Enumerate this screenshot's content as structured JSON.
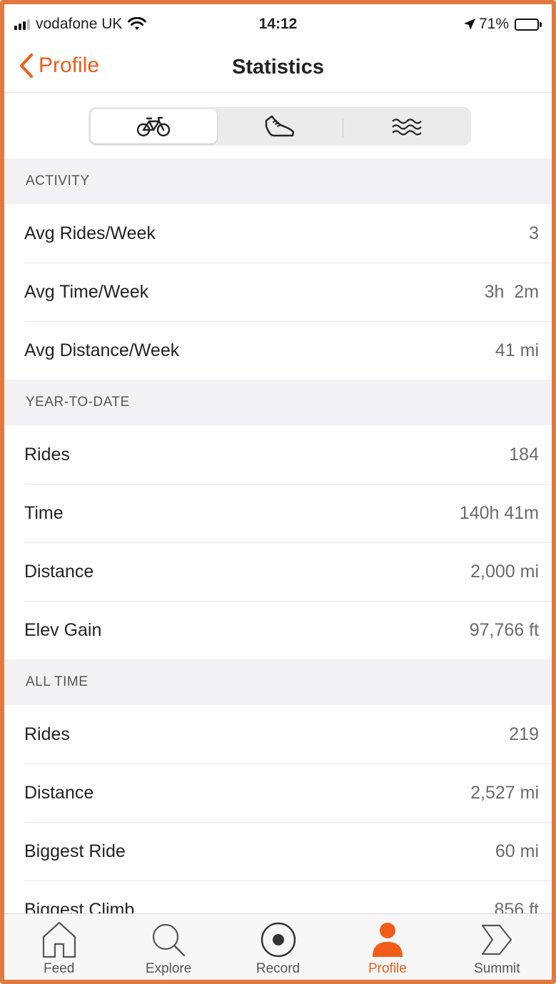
{
  "status": {
    "carrier": "vodafone UK",
    "time": "14:12",
    "battery": "71%",
    "battery_level": 0.71
  },
  "nav": {
    "back_label": "Profile",
    "title": "Statistics"
  },
  "sport_tabs": [
    {
      "icon": "bike-icon",
      "selected": true
    },
    {
      "icon": "shoe-icon",
      "selected": false
    },
    {
      "icon": "waves-icon",
      "selected": false
    }
  ],
  "sections": {
    "activity": {
      "header": "ACTIVITY",
      "rows": [
        {
          "label": "Avg Rides/Week",
          "value": "3"
        },
        {
          "label": "Avg Time/Week",
          "value": "3h  2m"
        },
        {
          "label": "Avg Distance/Week",
          "value": "41 mi"
        }
      ]
    },
    "ytd": {
      "header": "YEAR-TO-DATE",
      "rows": [
        {
          "label": "Rides",
          "value": "184"
        },
        {
          "label": "Time",
          "value": "140h 41m"
        },
        {
          "label": "Distance",
          "value": "2,000 mi"
        },
        {
          "label": "Elev Gain",
          "value": "97,766 ft"
        }
      ]
    },
    "all_time": {
      "header": "ALL TIME",
      "rows": [
        {
          "label": "Rides",
          "value": "219"
        },
        {
          "label": "Distance",
          "value": "2,527 mi"
        },
        {
          "label": "Biggest Ride",
          "value": "60 mi"
        },
        {
          "label": "Biggest Climb",
          "value": "856 ft"
        }
      ]
    }
  },
  "tab_bar": [
    {
      "label": "Feed",
      "icon": "house-icon"
    },
    {
      "label": "Explore",
      "icon": "magnifier-icon"
    },
    {
      "label": "Record",
      "icon": "record-icon"
    },
    {
      "label": "Profile",
      "icon": "person-icon",
      "active": true
    },
    {
      "label": "Summit",
      "icon": "summit-icon"
    }
  ],
  "colors": {
    "accent": "#f25c19",
    "frame": "#e07a3f",
    "section_bg": "#f2f2f4"
  }
}
